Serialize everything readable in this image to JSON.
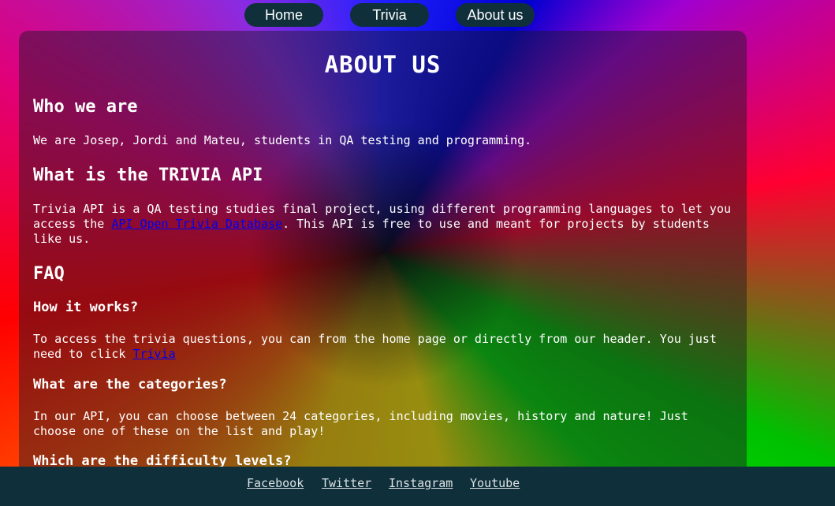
{
  "nav": {
    "home": "Home",
    "trivia": "Trivia",
    "about": "About us"
  },
  "title": "ABOUT US",
  "who": {
    "heading": "Who we are",
    "text": "We are Josep, Jordi and Mateu, students in QA testing and programming."
  },
  "what": {
    "heading": "What is the TRIVIA API",
    "text_before": "Trivia API is a QA testing studies final project, using different programming languages to let you access the ",
    "link": "API Open Trivia Database",
    "text_after": ". This API is free to use and meant for projects by students like us."
  },
  "faq": {
    "heading": "FAQ",
    "q1": "How it works?",
    "a1_before": "To access the trivia questions, you can from the home page or directly from our header. You just need to click ",
    "a1_link": "Trivia",
    "q2": "What are the categories?",
    "a2": "In our API, you can choose between 24 categories, including movies, history and nature! Just choose one of these on the list and play!",
    "q3": "Which are the difficulty levels?"
  },
  "footer": {
    "facebook": "Facebook",
    "twitter": "Twitter",
    "instagram": "Instagram",
    "youtube": "Youtube"
  },
  "colors": {
    "nav_bg": "#0f2f3a",
    "link": "#0000ee"
  }
}
